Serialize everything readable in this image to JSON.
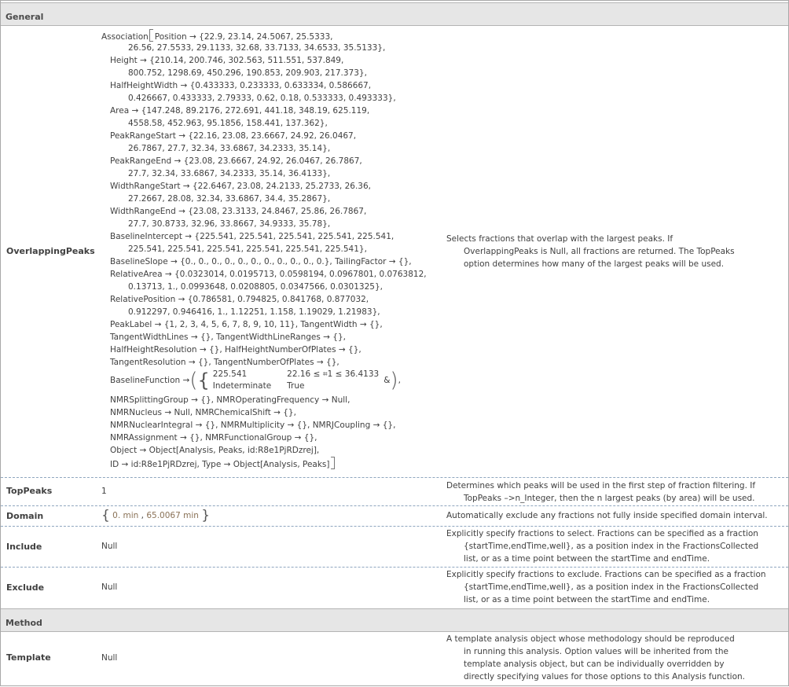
{
  "sections": {
    "general": "General",
    "method": "Method"
  },
  "overlapping": {
    "name": "OverlappingPeaks",
    "lines": [
      {
        "t": "Association",
        "cls": "",
        "open": true,
        "rest": "Position → {22.9, 23.14, 24.5067, 25.5333,"
      },
      {
        "t": "26.56, 27.5533, 29.1133, 32.68, 33.7133, 34.6533, 35.5133},",
        "cls": "i3"
      },
      {
        "t": "Height → {210.14, 200.746, 302.563, 511.551, 537.849,",
        "cls": "i1"
      },
      {
        "t": "800.752, 1298.69, 450.296, 190.853, 209.903, 217.373},",
        "cls": "i3"
      },
      {
        "t": "HalfHeightWidth → {0.433333, 0.233333, 0.633334, 0.586667,",
        "cls": "i1"
      },
      {
        "t": "0.426667, 0.433333, 2.79333, 0.62, 0.18, 0.533333, 0.493333},",
        "cls": "i3"
      },
      {
        "t": "Area → {147.248, 89.2176, 272.691, 441.18, 348.19, 625.119,",
        "cls": "i1"
      },
      {
        "t": "4558.58, 452.963, 95.1856, 158.441, 137.362},",
        "cls": "i3"
      },
      {
        "t": "PeakRangeStart → {22.16, 23.08, 23.6667, 24.92, 26.0467,",
        "cls": "i1"
      },
      {
        "t": "26.7867, 27.7, 32.34, 33.6867, 34.2333, 35.14},",
        "cls": "i3"
      },
      {
        "t": "PeakRangeEnd → {23.08, 23.6667, 24.92, 26.0467, 26.7867,",
        "cls": "i1"
      },
      {
        "t": "27.7, 32.34, 33.6867, 34.2333, 35.14, 36.4133},",
        "cls": "i3"
      },
      {
        "t": "WidthRangeStart → {22.6467, 23.08, 24.2133, 25.2733, 26.36,",
        "cls": "i1"
      },
      {
        "t": "27.2667, 28.08, 32.34, 33.6867, 34.4, 35.2867},",
        "cls": "i3"
      },
      {
        "t": "WidthRangeEnd → {23.08, 23.3133, 24.8467, 25.86, 26.7867,",
        "cls": "i1"
      },
      {
        "t": "27.7, 30.8733, 32.96, 33.8667, 34.9333, 35.78},",
        "cls": "i3"
      },
      {
        "t": "BaselineIntercept → {225.541, 225.541, 225.541, 225.541, 225.541,",
        "cls": "i1"
      },
      {
        "t": "225.541, 225.541, 225.541, 225.541, 225.541, 225.541},",
        "cls": "i3"
      },
      {
        "t": "BaselineSlope → {0., 0., 0., 0., 0., 0., 0., 0., 0., 0., 0.}, TailingFactor → {},",
        "cls": "i1"
      },
      {
        "t": "RelativeArea → {0.0323014, 0.0195713, 0.0598194, 0.0967801, 0.0763812,",
        "cls": "i1"
      },
      {
        "t": "0.13713, 1., 0.0993648, 0.0208805, 0.0347566, 0.0301325},",
        "cls": "i3"
      },
      {
        "t": "RelativePosition → {0.786581, 0.794825, 0.841768, 0.877032,",
        "cls": "i1"
      },
      {
        "t": "0.912297, 0.946416, 1., 1.12251, 1.158, 1.19029, 1.21983},",
        "cls": "i3"
      },
      {
        "t": "PeakLabel → {1, 2, 3, 4, 5, 6, 7, 8, 9, 10, 11}, TangentWidth → {},",
        "cls": "i1"
      },
      {
        "t": "TangentWidthLines → {}, TangentWidthLineRanges → {},",
        "cls": "i1"
      },
      {
        "t": "HalfHeightResolution → {}, HalfHeightNumberOfPlates → {},",
        "cls": "i1"
      },
      {
        "t": "TangentResolution → {}, TangentNumberOfPlates → {},",
        "cls": "i1"
      }
    ],
    "baseline_fn": {
      "label": "BaselineFunction →",
      "r1c1": "225.541",
      "r1c2": "22.16 ≤ ⌗1 ≤ 36.4133",
      "r2c1": "Indeterminate",
      "r2c2": "True",
      "tail": "&",
      "end": ","
    },
    "lines2": [
      {
        "t": "NMRSplittingGroup → {}, NMROperatingFrequency → Null,",
        "cls": "i1"
      },
      {
        "t": "NMRNucleus → Null, NMRChemicalShift → {},",
        "cls": "i1"
      },
      {
        "t": "NMRNuclearIntegral → {}, NMRMultiplicity → {}, NMRJCoupling → {},",
        "cls": "i1"
      },
      {
        "t": "NMRAssignment → {}, NMRFunctionalGroup → {},",
        "cls": "i1"
      },
      {
        "t": "Object → Object[Analysis, Peaks, id:R8e1PjRDzrej],",
        "cls": "i1"
      }
    ],
    "last_line": "ID → id:R8e1PjRDzrej, Type → Object[Analysis, Peaks]",
    "desc": [
      "Selects fractions that overlap with the largest peaks. If",
      "OverlappingPeaks is Null, all fractions are returned. The TopPeaks",
      "option determines how many of the largest peaks will be used."
    ]
  },
  "toppeaks": {
    "name": "TopPeaks",
    "value": "1",
    "desc": [
      "Determines which peaks will be used in the first step of fraction filtering. If",
      "TopPeaks –>n_Integer, then the n largest peaks (by area) will be used."
    ]
  },
  "domain": {
    "name": "Domain",
    "v1": "0. min",
    "v2": "65.0067 min",
    "desc": [
      "Automatically exclude any fractions not fully inside specified domain interval."
    ]
  },
  "include": {
    "name": "Include",
    "value": "Null",
    "desc": [
      "Explicitly specify fractions to select. Fractions can be specified as a fraction",
      "{startTime,endTime,well}, as a position index in the FractionsCollected",
      "list, or as a time point between the startTime and endTime."
    ]
  },
  "exclude": {
    "name": "Exclude",
    "value": "Null",
    "desc": [
      "Explicitly specify fractions to exclude.  Fractions can be specified as a fraction",
      "{startTime,endTime,well}, as a position index in the FractionsCollected",
      "list, or as a time point between the startTime and endTime."
    ]
  },
  "template": {
    "name": "Template",
    "value": "Null",
    "desc": [
      "A template analysis object whose methodology should be reproduced",
      "in running this analysis. Option values will be inherited from the",
      "template analysis object, but can be individually overridden by",
      "directly specifying values for those options to this Analysis function."
    ]
  }
}
